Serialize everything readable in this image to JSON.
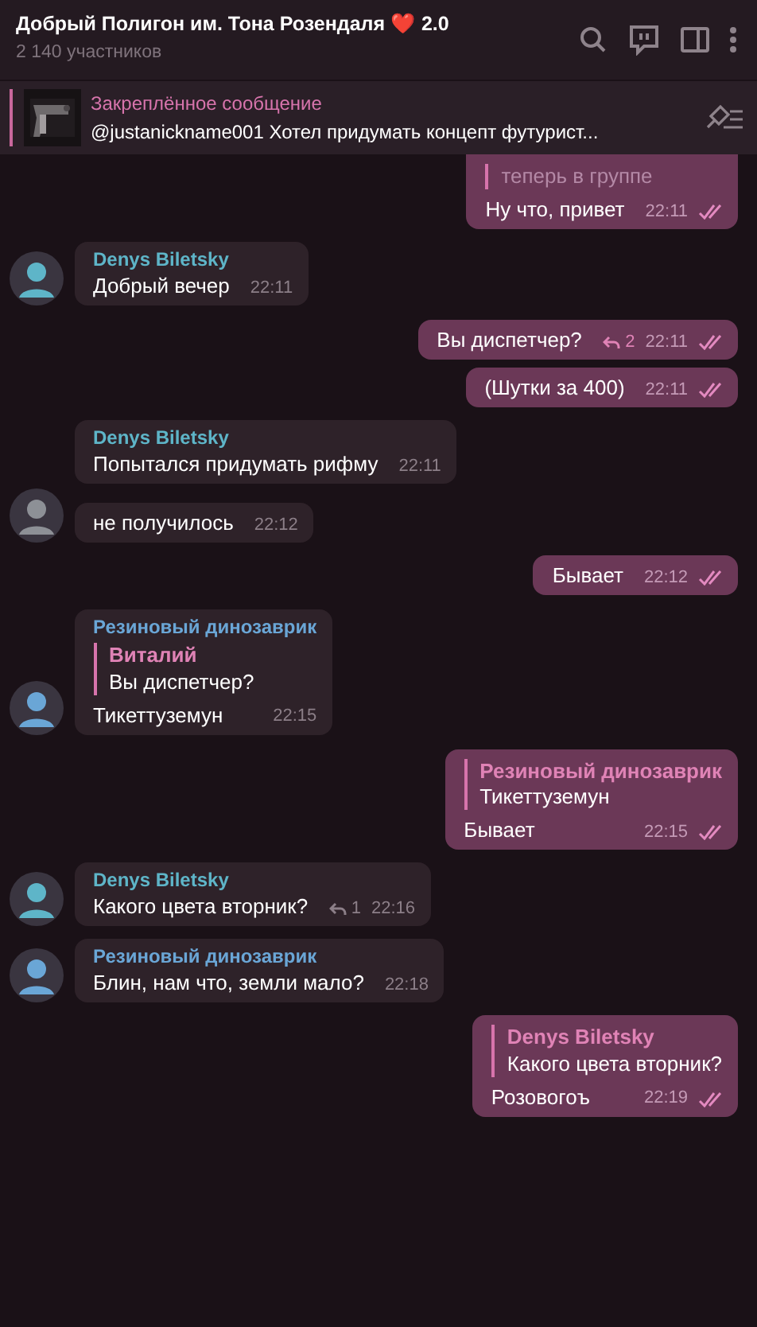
{
  "header": {
    "title": "Добрый Полигон им. Тона Розендаля",
    "title_emoji": "❤️",
    "title_suffix": "2.0",
    "subtitle": "2 140 участников"
  },
  "pinned": {
    "label": "Закреплённое сообщение",
    "text": "@justanickname001  Хотел придумать концепт футурист..."
  },
  "messages": [
    {
      "kind": "outgoing",
      "quote_text": "теперь в группе",
      "text": "Ну что, привет",
      "time": "22:11",
      "read": true
    },
    {
      "kind": "incoming",
      "author": "Denys Biletsky",
      "color": "#5eb5c8",
      "avatar": true,
      "text": "Добрый вечер",
      "time": "22:11"
    },
    {
      "kind": "outgoing",
      "text": "Вы диспетчер?",
      "replies": "2",
      "time": "22:11",
      "read": true
    },
    {
      "kind": "outgoing",
      "text": "(Шутки за 400)",
      "time": "22:11",
      "read": true
    },
    {
      "kind": "incoming",
      "author": "Denys Biletsky",
      "color": "#5eb5c8",
      "avatar": false,
      "text": "Попытался придумать рифму",
      "time": "22:11"
    },
    {
      "kind": "incoming",
      "avatar": true,
      "text": "не получилось",
      "time": "22:12"
    },
    {
      "kind": "outgoing",
      "text": "Бывает",
      "time": "22:12",
      "read": true
    },
    {
      "kind": "incoming",
      "author": "Резиновый динозаврик",
      "color": "#6aa6d6",
      "avatar": true,
      "quote_author": "Виталий",
      "quote_text": "Вы диспетчер?",
      "text": "Тикеттуземун",
      "time": "22:15"
    },
    {
      "kind": "outgoing",
      "quote_author": "Резиновый динозаврик",
      "quote_text": "Тикеттуземун",
      "text": "Бывает",
      "time": "22:15",
      "read": true
    },
    {
      "kind": "incoming",
      "author": "Denys Biletsky",
      "color": "#5eb5c8",
      "avatar": true,
      "text": "Какого цвета вторник?",
      "replies": "1",
      "time": "22:16"
    },
    {
      "kind": "incoming",
      "author": "Резиновый динозаврик",
      "color": "#6aa6d6",
      "avatar": true,
      "text": "Блин, нам что, земли мало?",
      "time": "22:18"
    },
    {
      "kind": "outgoing",
      "quote_author": "Denys Biletsky",
      "quote_text": "Какого цвета вторник?",
      "text": "Розовогоъ",
      "time": "22:19",
      "read": true
    }
  ]
}
